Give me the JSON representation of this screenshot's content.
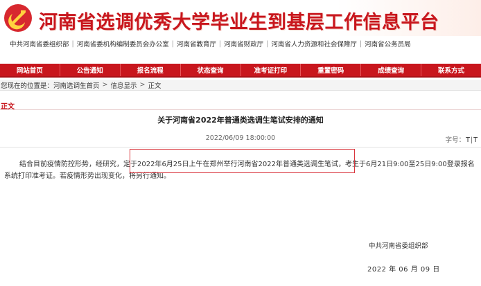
{
  "header": {
    "site_title": "河南省选调优秀大学毕业生到基层工作信息平台",
    "emblem_icon": "party-emblem-icon",
    "brand_color": "#c8161d",
    "organizations": [
      "中共河南省委组织部",
      "河南省委机构编制委员会办公室",
      "河南省教育厅",
      "河南省财政厅",
      "河南省人力资源和社会保障厅",
      "河南省公务员局"
    ]
  },
  "nav": {
    "items": [
      "网站首页",
      "公告通知",
      "报名流程",
      "状态查询",
      "准考证打印",
      "重置密码",
      "成绩查询",
      "联系方式"
    ]
  },
  "breadcrumb": {
    "prefix": "您现在的位置是：",
    "items": [
      "河南选调生首页",
      "信息显示",
      "正文"
    ],
    "separator": ">"
  },
  "section": {
    "label": "正文"
  },
  "article": {
    "title": "关于河南省2022年普通类选调生笔试安排的通知",
    "date": "2022/06/09 18:00:00",
    "font_size_label": "字号：",
    "font_size_controls": [
      "T",
      "T"
    ],
    "font_size_sep": "|",
    "body_part1": "结合目前疫情防控形势，经研究，定于2022年6月25日上午在郑州举行河南省2022年普通类选调生笔试，考生于6月21日9:00至25日9:00登录",
    "body_part2": "报名系统打印准考证。若疫情形势出现变化，将另行通知。",
    "signature_org": "中共河南省委组织部",
    "signature_date": "2022 年 06 月 09 日"
  }
}
